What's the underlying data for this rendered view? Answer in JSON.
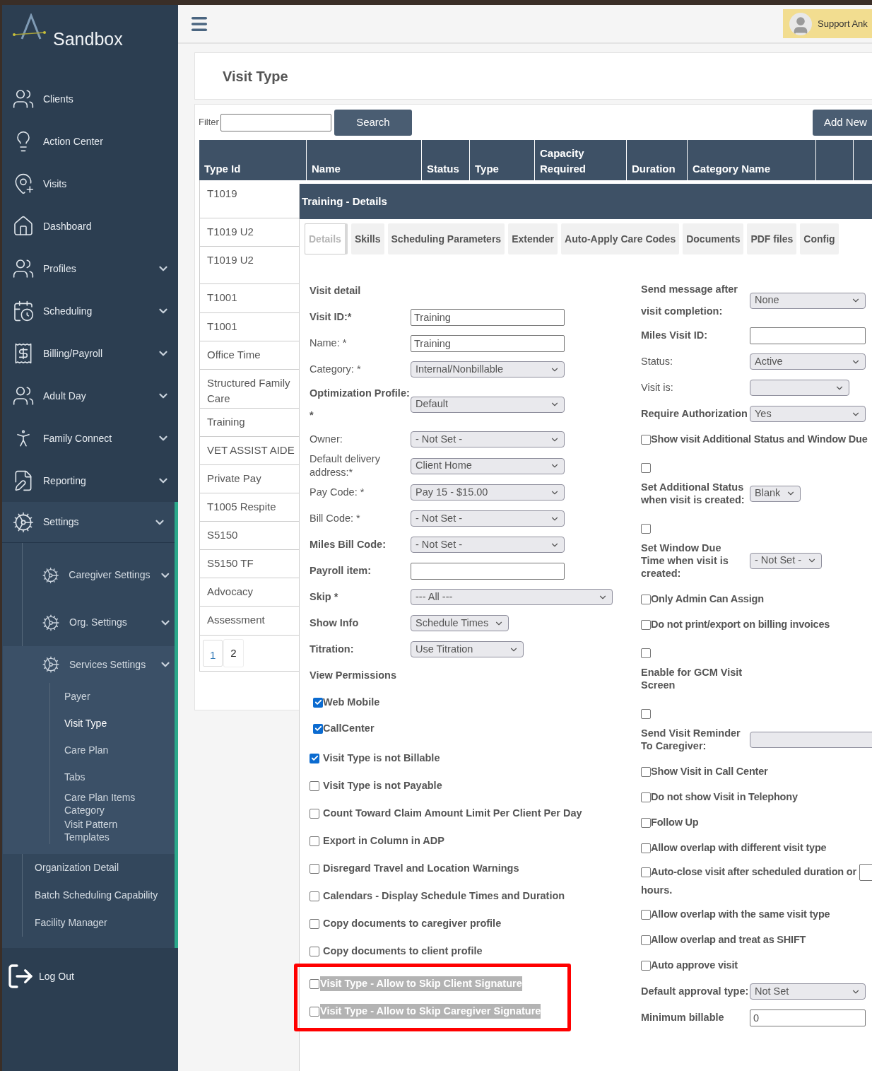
{
  "sidebar": {
    "title": "Sandbox",
    "items": [
      {
        "label": "Clients"
      },
      {
        "label": "Action Center"
      },
      {
        "label": "Visits"
      },
      {
        "label": "Dashboard"
      },
      {
        "label": "Profiles",
        "expanded": false
      },
      {
        "label": "Scheduling",
        "expanded": false
      },
      {
        "label": "Billing/Payroll",
        "expanded": false
      },
      {
        "label": "Adult Day",
        "expanded": false
      },
      {
        "label": "Family Connect",
        "expanded": false
      },
      {
        "label": "Reporting",
        "expanded": false
      },
      {
        "label": "Settings",
        "expanded": true,
        "children": [
          {
            "label": "Caregiver Settings",
            "expanded": false
          },
          {
            "label": "Org. Settings",
            "expanded": false
          },
          {
            "label": "Services Settings",
            "expanded": true,
            "children": [
              {
                "label": "Payer",
                "selected": false
              },
              {
                "label": "Visit Type",
                "selected": true
              },
              {
                "label": "Care Plan",
                "selected": false
              },
              {
                "label": "Tabs",
                "selected": false
              },
              {
                "label": "Care Plan Items Category",
                "selected": false
              },
              {
                "label": "Visit Pattern Templates",
                "selected": false
              }
            ]
          },
          {
            "label": "Organization Detail"
          },
          {
            "label": "Batch Scheduling Capability"
          },
          {
            "label": "Facility Manager"
          }
        ]
      }
    ],
    "logout": "Log Out"
  },
  "header": {
    "user": "Support Ank"
  },
  "page_title": "Visit Type",
  "toolbar": {
    "filter_label": "Filter",
    "search_button": "Search",
    "add_button": "Add New"
  },
  "table": {
    "columns": [
      "Type Id",
      "Name",
      "Status",
      "Type",
      "Capacity Required",
      "Duration",
      "Category Name"
    ],
    "rows": [
      "T1019",
      "T1019 U2",
      "T1019 U2",
      "T1001",
      "T1001",
      "Office Time",
      "Structured Family Care",
      "Training",
      "VET ASSIST AIDE",
      "Private Pay",
      "T1005 Respite",
      "S5150",
      "S5150 TF",
      "Advocacy",
      "Assessment"
    ],
    "pages": [
      {
        "label": "1",
        "selected": true
      },
      {
        "label": "2",
        "selected": false
      }
    ]
  },
  "details": {
    "title": "Training - Details",
    "tabs": [
      {
        "label": "Details",
        "selected": true
      },
      {
        "label": "Skills",
        "selected": false
      },
      {
        "label": "Scheduling Parameters",
        "selected": false
      },
      {
        "label": "Extender",
        "selected": false
      },
      {
        "label": "Auto-Apply Care Codes",
        "selected": false
      },
      {
        "label": "Documents",
        "selected": false
      },
      {
        "label": "PDF files",
        "selected": false
      },
      {
        "label": "Config",
        "selected": false
      }
    ],
    "heading": "Visit detail",
    "fields": [
      {
        "kind": "text",
        "label": "Visit ID:*",
        "bold": true,
        "value": "Training"
      },
      {
        "kind": "text",
        "label": "Name: *",
        "bold": false,
        "value": "Training"
      },
      {
        "kind": "select",
        "label": "Category: *",
        "bold": false,
        "value": "Internal/Nonbillable"
      },
      {
        "kind": "select",
        "label": "Optimization Profile: *",
        "bold": true,
        "value": "Default"
      },
      {
        "kind": "select",
        "label": "Owner:",
        "bold": false,
        "value": "- Not Set -"
      },
      {
        "kind": "select",
        "label": "Default delivery address:*",
        "bold": false,
        "value": "Client Home"
      },
      {
        "kind": "select",
        "label": "Pay Code: *",
        "bold": false,
        "value": "Pay 15 - $15.00"
      },
      {
        "kind": "select",
        "label": "Bill Code: *",
        "bold": false,
        "value": "- Not Set -"
      },
      {
        "kind": "select",
        "label": "Miles Bill Code:",
        "bold": true,
        "value": "- Not Set -"
      },
      {
        "kind": "text",
        "label": "Payroll item:",
        "bold": true
      },
      {
        "kind": "select-wide",
        "label": "Skip *",
        "bold": true,
        "value": "--- All ---"
      },
      {
        "kind": "select-compact",
        "label": "Show Info",
        "bold": true,
        "value": "Schedule Times"
      },
      {
        "kind": "select-mid",
        "label": "Titration:",
        "bold": true,
        "value": "Use Titration"
      }
    ],
    "view_permissions": {
      "label": "View Permissions",
      "options": [
        {
          "label": "Web Mobile",
          "checked": true
        },
        {
          "label": "CallCenter",
          "checked": true
        }
      ]
    },
    "options": [
      {
        "label": "Visit Type is not Billable",
        "checked": true,
        "highlighted": false
      },
      {
        "label": "Visit Type is not Payable",
        "checked": false,
        "highlighted": false
      },
      {
        "label": "Count Toward Claim Amount Limit Per Client Per Day",
        "checked": false,
        "highlighted": false
      },
      {
        "label": "Export in Column in ADP",
        "checked": false,
        "highlighted": false
      },
      {
        "label": "Disregard Travel and Location Warnings",
        "checked": false,
        "highlighted": false
      },
      {
        "label": "Calendars - Display Schedule Times and Duration",
        "checked": false,
        "highlighted": false
      },
      {
        "label": "Copy documents to caregiver profile",
        "checked": false,
        "highlighted": false
      },
      {
        "label": "Copy documents to client profile",
        "checked": false,
        "highlighted": false
      },
      {
        "label": "Visit Type - Allow to Skip Client Signature",
        "checked": false,
        "highlighted": true
      },
      {
        "label": "Visit Type - Allow to Skip Caregiver Signature",
        "checked": false,
        "highlighted": true
      }
    ],
    "right": [
      {
        "kind": "select",
        "label": "Send message after visit completion:",
        "bold": true,
        "value": "None"
      },
      {
        "kind": "text",
        "label": "Miles Visit ID:",
        "bold": true
      },
      {
        "kind": "select",
        "label": "Status:",
        "bold": false,
        "value": "Active"
      },
      {
        "kind": "select-compact",
        "label": "Visit is:",
        "bold": false
      },
      {
        "kind": "select",
        "label": "Require Authorization",
        "bold": true,
        "value": "Yes"
      },
      {
        "kind": "checkbox",
        "label": "Show visit Additional Status and Window Due",
        "checked": false
      },
      {
        "kind": "checkbox-block-select",
        "label": "Set Additional Status when visit is created:",
        "checked": false,
        "value": "Blank"
      },
      {
        "kind": "checkbox-block-select",
        "label": "Set Window Due Time when visit is created:",
        "checked": false,
        "value": "- Not Set -"
      },
      {
        "kind": "checkbox",
        "label": "Only Admin Can Assign",
        "checked": false
      },
      {
        "kind": "checkbox",
        "label": "Do not print/export on billing invoices",
        "checked": false
      },
      {
        "kind": "checkbox-block",
        "label": "Enable for GCM Visit Screen",
        "checked": false
      },
      {
        "kind": "checkbox-block-select",
        "label": "Send Visit Reminder To Caregiver:",
        "checked": false
      },
      {
        "kind": "checkbox",
        "label": "Show Visit in Call Center",
        "checked": false
      },
      {
        "kind": "checkbox",
        "label": "Do not show Visit in Telephony",
        "checked": false
      },
      {
        "kind": "checkbox",
        "label": "Follow Up",
        "checked": false
      },
      {
        "kind": "checkbox",
        "label": "Allow overlap with different visit type",
        "checked": false
      },
      {
        "kind": "checkbox-field",
        "label": "Auto-close visit after scheduled duration or",
        "suffix": "hours.",
        "checked": false
      },
      {
        "kind": "checkbox",
        "label": "Allow overlap with the same visit type",
        "checked": false
      },
      {
        "kind": "checkbox",
        "label": "Allow overlap and treat as SHIFT",
        "checked": false
      },
      {
        "kind": "checkbox",
        "label": "Auto approve visit",
        "checked": false
      },
      {
        "kind": "select",
        "label": "Default approval type:",
        "bold": true,
        "value": "Not Set"
      },
      {
        "kind": "text",
        "label": "Minimum billable",
        "bold": true,
        "value": "0"
      }
    ]
  }
}
